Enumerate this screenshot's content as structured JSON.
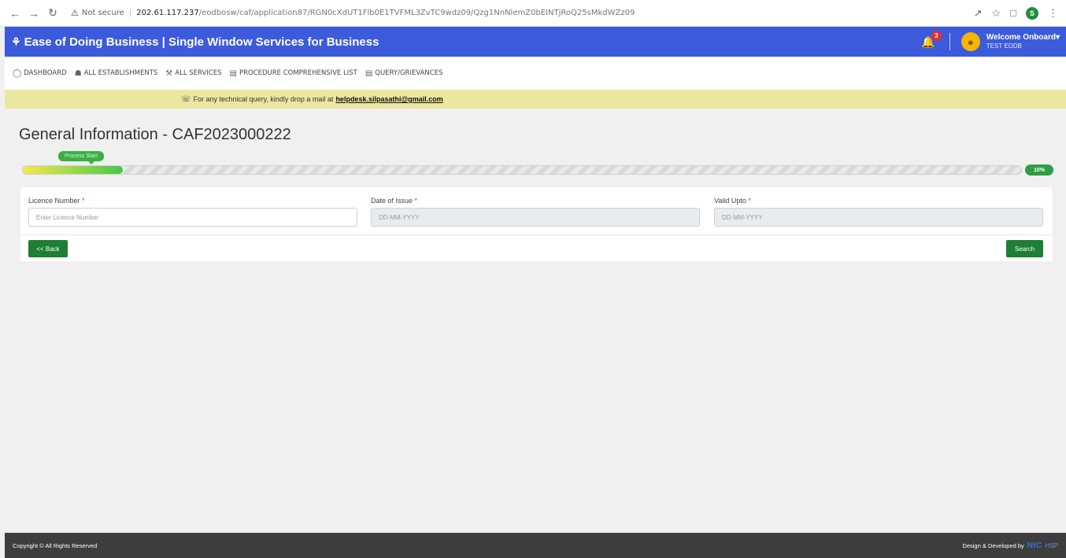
{
  "browser": {
    "security_label": "Not secure",
    "url_host": "202.61.117.237",
    "url_path": "/eodbosw/caf/application87/RGN0cXdUT1Flb0E1TVFML3ZvTC9wdz09/Qzg1NnNlemZ0bEINTjRoQ25sMkdWZz09",
    "profile_initial": "S"
  },
  "header": {
    "title": "Ease of Doing Business | Single Window Services for Business",
    "notification_count": "3",
    "welcome_text": "Welcome Onboard",
    "user_name": "TEST EODB"
  },
  "nav": {
    "items": [
      {
        "label": "DASHBOARD",
        "icon": "dashboard-icon"
      },
      {
        "label": "ALL ESTABLISHMENTS",
        "icon": "building-icon"
      },
      {
        "label": "ALL SERVICES",
        "icon": "wrench-icon"
      },
      {
        "label": "PROCEDURE COMPREHENSIVE LIST",
        "icon": "list-icon"
      },
      {
        "label": "QUERY/GRIEVANCES",
        "icon": "list-icon"
      }
    ]
  },
  "notice": {
    "text": "For any technical query, kindly drop a mail at",
    "email": "helpdesk.silpasathi@gmail.com"
  },
  "page": {
    "title": "General Information - CAF2023000222"
  },
  "progress": {
    "stage_label": "Process Start",
    "percent_label": "10%",
    "fraction": 0.1
  },
  "form": {
    "licence_label": "Licence Number",
    "licence_placeholder": "Enter Licence Number",
    "issue_label": "Date of Issue",
    "issue_placeholder": "DD-MM-YYYY",
    "valid_label": "Valid Upto",
    "valid_placeholder": "DD-MM-YYYY",
    "required_mark": "*",
    "back_label": "<< Back",
    "search_label": "Search"
  },
  "footer": {
    "copyright": "Copyright © All Rights Reserved",
    "developed_by": "Design & Developed by",
    "nic_logo": "NIC",
    "nic_suffix": "HSP"
  },
  "colors": {
    "header_blue": "#3b5bdb",
    "notice_yellow": "#ebe6a0",
    "button_green": "#1e7e34",
    "footer_dark": "#3d3d3d"
  }
}
